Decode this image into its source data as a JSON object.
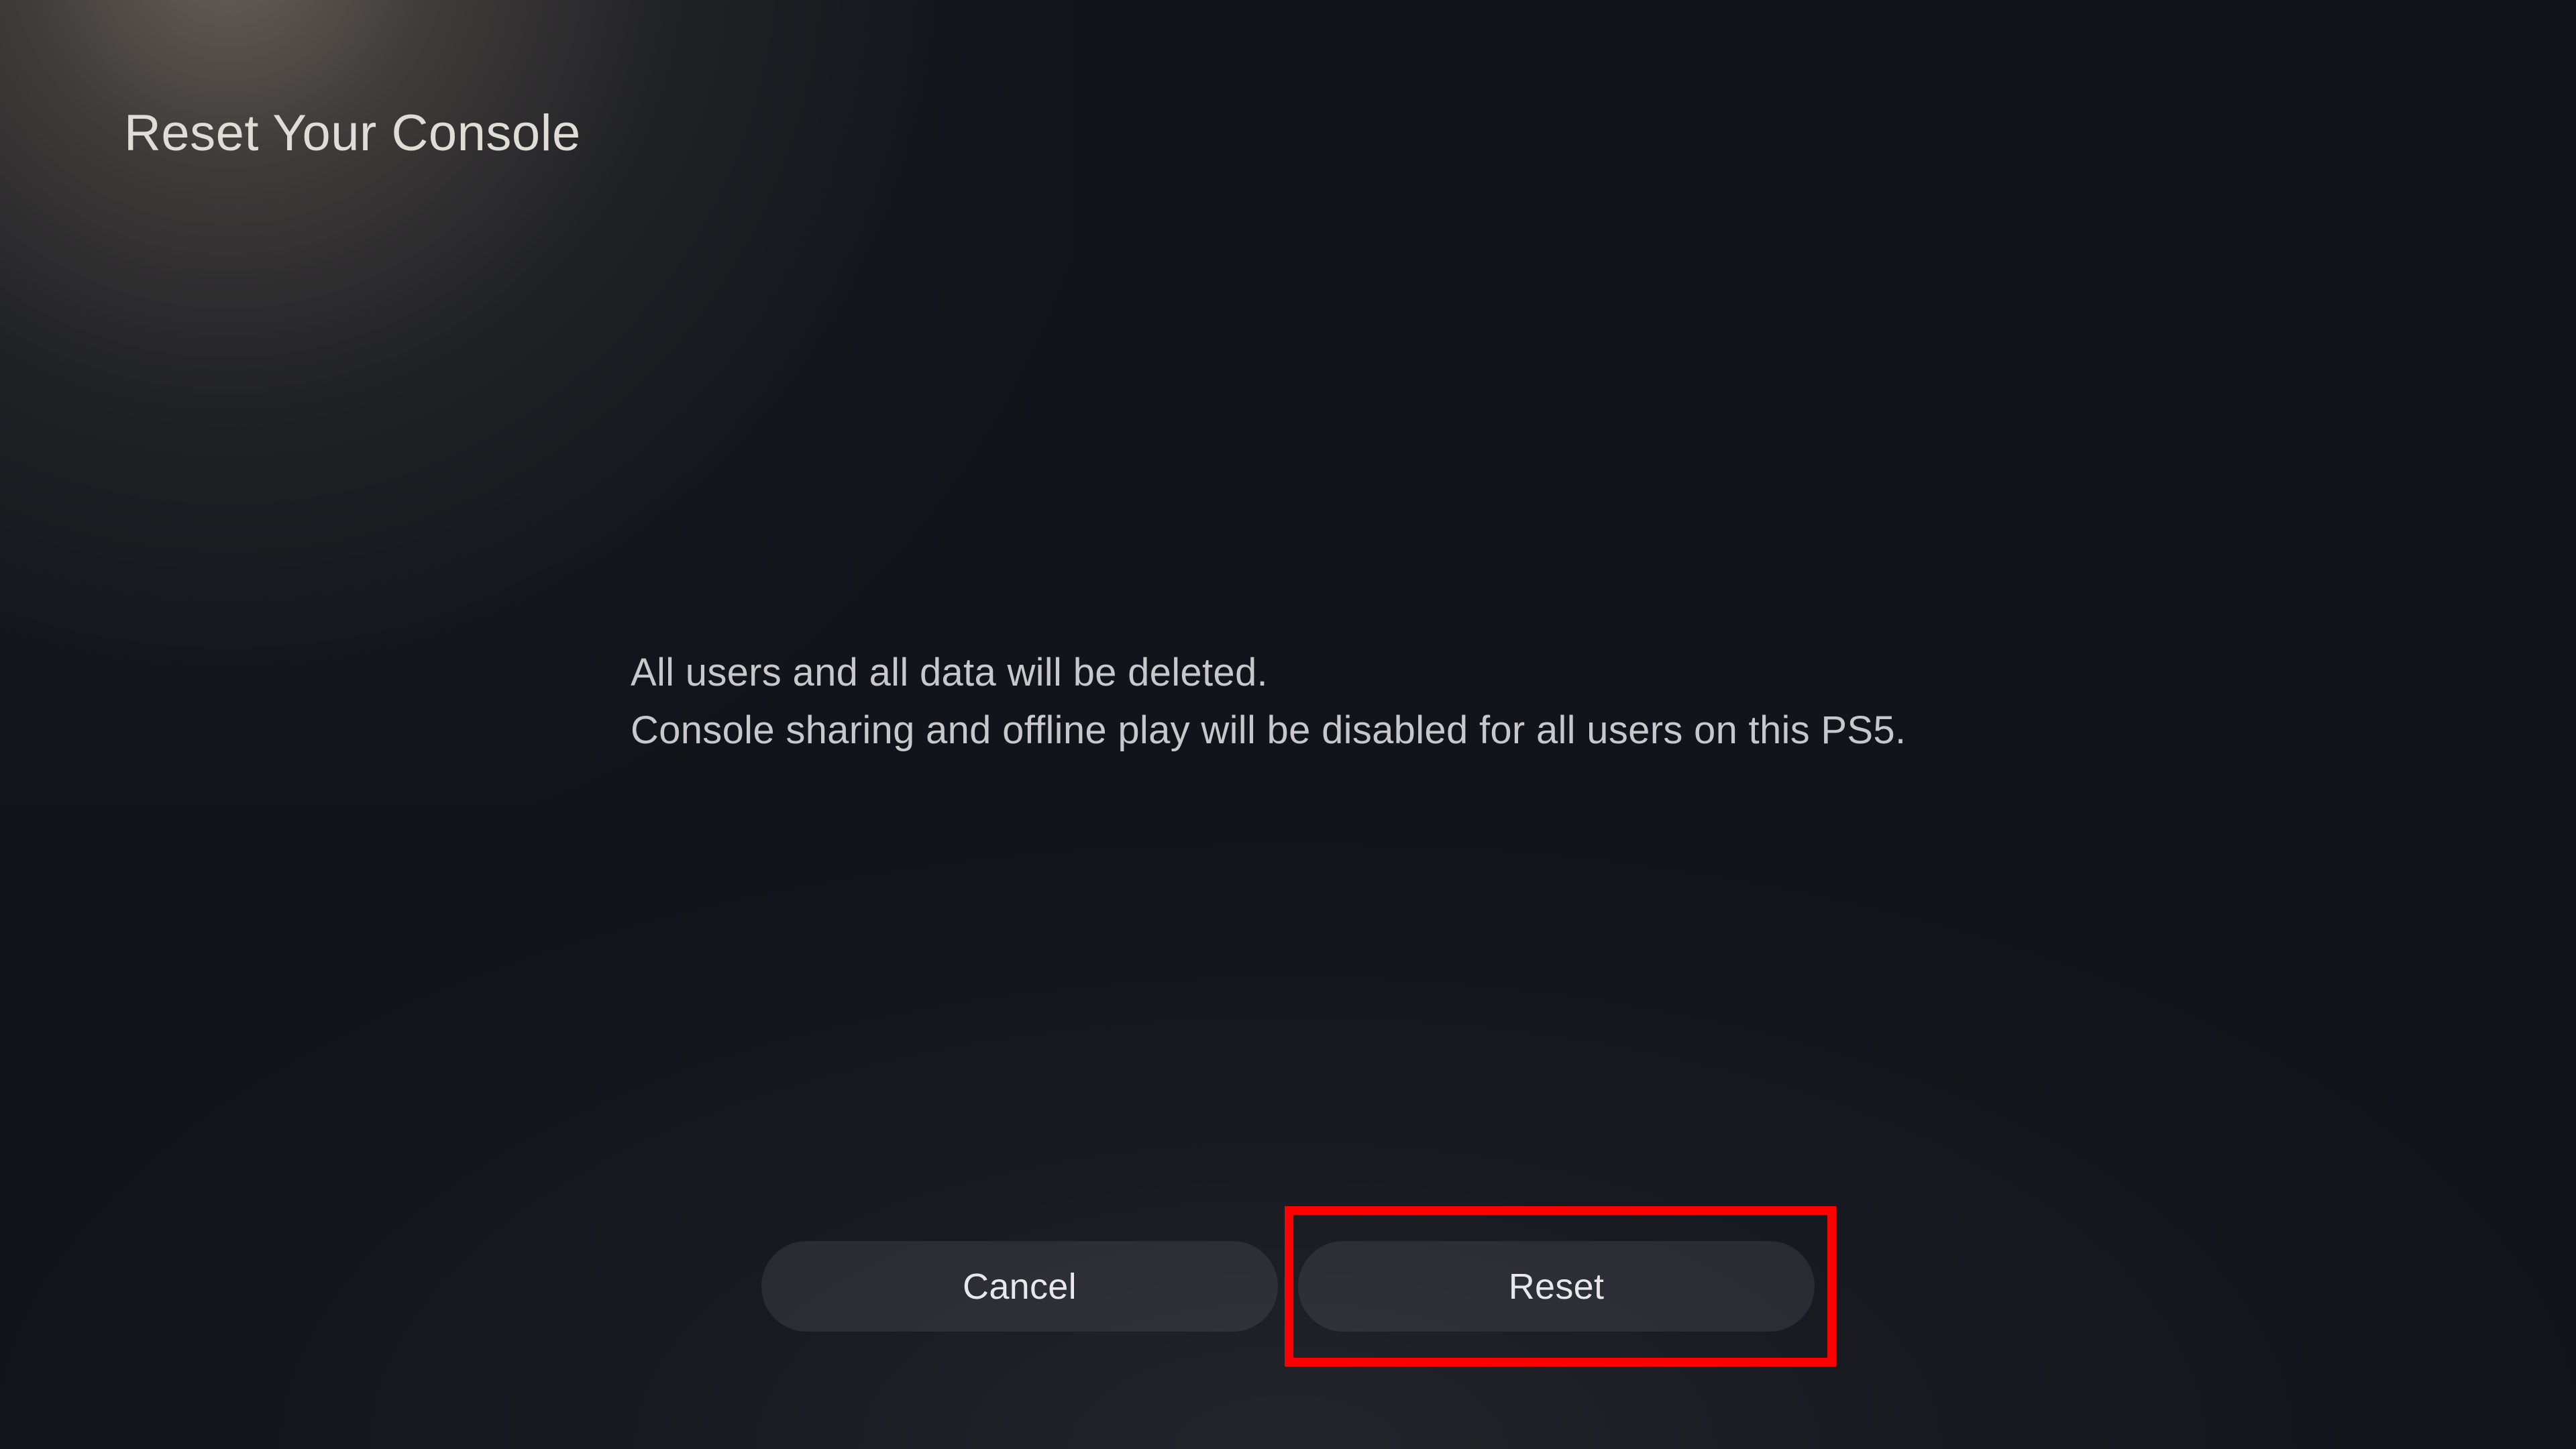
{
  "header": {
    "title": "Reset Your Console"
  },
  "message": {
    "line1": "All users and all data will be deleted.",
    "line2": "Console sharing and offline play will be disabled for all users on this PS5."
  },
  "buttons": {
    "cancel_label": "Cancel",
    "reset_label": "Reset"
  },
  "annotation": {
    "highlighted_button": "reset",
    "highlight_color": "#ff0000"
  }
}
